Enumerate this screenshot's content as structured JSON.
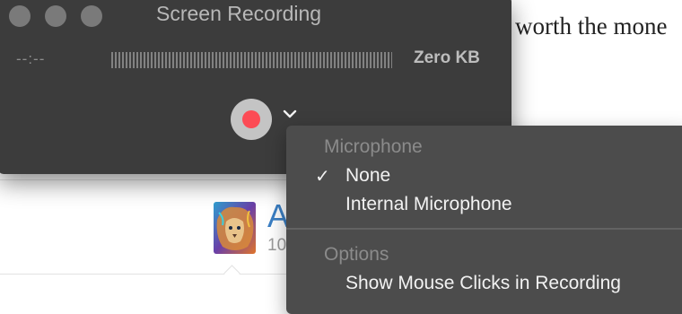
{
  "background_document": {
    "body_text": "worth the mone",
    "author_name": "A",
    "author_meta": "10"
  },
  "recording_window": {
    "title": "Screen Recording",
    "elapsed_time": "--:--",
    "file_size": "Zero KB",
    "record_color": "#fc4b55"
  },
  "menu": {
    "sections": [
      {
        "header": "Microphone",
        "items": [
          {
            "label": "None",
            "checked": true
          },
          {
            "label": "Internal Microphone",
            "checked": false
          }
        ]
      },
      {
        "header": "Options",
        "items": [
          {
            "label": "Show Mouse Clicks in Recording",
            "checked": false
          }
        ]
      }
    ],
    "check_glyph": "✓"
  }
}
